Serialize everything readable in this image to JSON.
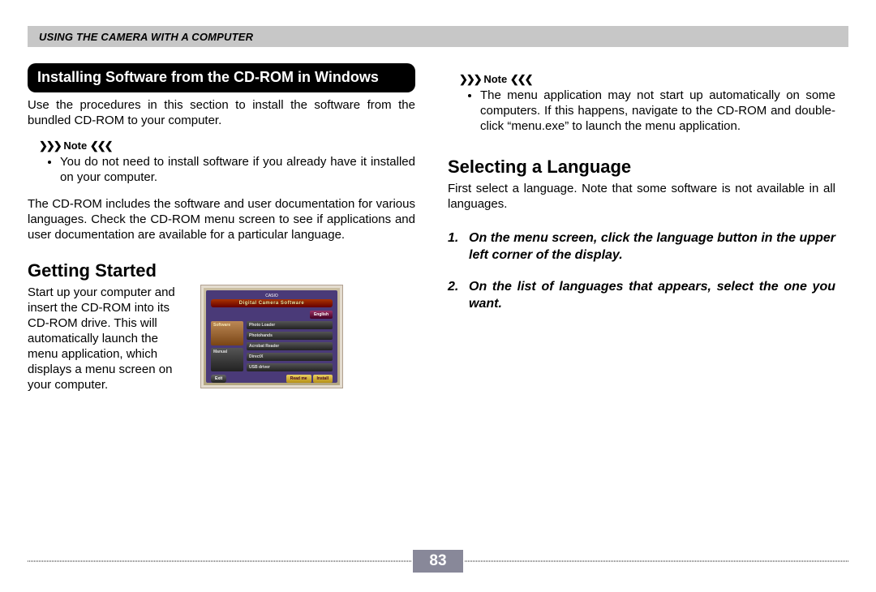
{
  "header": {
    "title": "USING THE CAMERA WITH A COMPUTER"
  },
  "left": {
    "pill_title": "Installing Software from the CD-ROM in Windows",
    "intro": "Use the procedures in this section to install the software from the bundled CD-ROM to your computer.",
    "note_label": "Note",
    "note_items": [
      "You do not need to install software if you already have it installed on your computer."
    ],
    "para2": "The CD-ROM includes the software and user documentation for various languages. Check the CD-ROM menu screen to see if applications and user documentation are available for a particular language.",
    "h2": "Getting Started",
    "gs_text": "Start up your computer and insert the CD-ROM into its CD-ROM drive. This will automatically launch the menu application, which displays a menu screen on your computer.",
    "thumb": {
      "brand": "CASIO",
      "banner": "Digital Camera Software",
      "left_buttons": [
        "Software",
        "Manual"
      ],
      "right_buttons": [
        "Photo Loader",
        "Photohands",
        "Acrobat Reader",
        "DirectX",
        "USB driver"
      ],
      "exit": "Exit",
      "actions": [
        "Read me",
        "Install"
      ],
      "lang": "English"
    }
  },
  "right": {
    "note_label": "Note",
    "note_items": [
      "The menu application may not start up automatically on some computers. If this happens, navigate to the CD-ROM and double-click “menu.exe” to launch the menu application."
    ],
    "h2": "Selecting a Language",
    "para": "First select a language. Note that some software is not available in all languages.",
    "steps": [
      "On the menu screen, click the language button in the upper left corner of the display.",
      "On the list of languages that appears, select the one you want."
    ]
  },
  "page_number": "83"
}
